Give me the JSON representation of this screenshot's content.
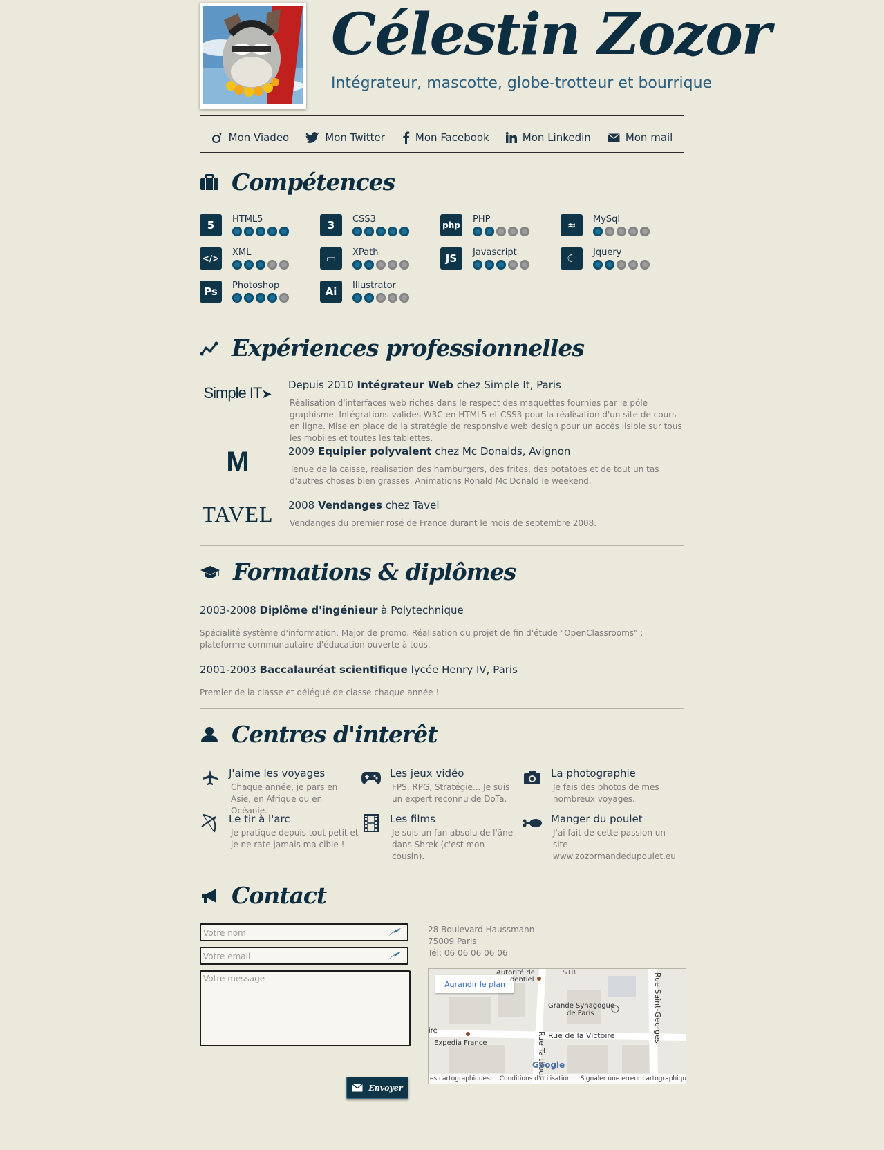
{
  "header": {
    "name": "Célestin Zozor",
    "tagline": "Intégrateur, mascotte, globe-trotteur et bourrique"
  },
  "nav": [
    {
      "label": "Mon Viadeo",
      "icon": "viadeo-icon"
    },
    {
      "label": "Mon Twitter",
      "icon": "twitter-icon"
    },
    {
      "label": "Mon Facebook",
      "icon": "facebook-icon"
    },
    {
      "label": "Mon Linkedin",
      "icon": "linkedin-icon"
    },
    {
      "label": "Mon mail",
      "icon": "mail-icon"
    }
  ],
  "skills": {
    "title": "Compétences",
    "items": [
      {
        "label": "HTML5",
        "glyph": "5",
        "icon": "html5-icon",
        "rating": 5
      },
      {
        "label": "CSS3",
        "glyph": "3",
        "icon": "css3-icon",
        "rating": 5
      },
      {
        "label": "PHP",
        "glyph": "php",
        "icon": "php-icon",
        "rating": 2
      },
      {
        "label": "MySql",
        "glyph": "≈",
        "icon": "mysql-icon",
        "rating": 1
      },
      {
        "label": "XML",
        "glyph": "</>",
        "icon": "xml-icon",
        "rating": 3
      },
      {
        "label": "XPath",
        "glyph": "▭",
        "icon": "xpath-icon",
        "rating": 2
      },
      {
        "label": "Javascript",
        "glyph": "JS",
        "icon": "javascript-icon",
        "rating": 3
      },
      {
        "label": "Jquery",
        "glyph": "☾",
        "icon": "jquery-icon",
        "rating": 2
      },
      {
        "label": "Photoshop",
        "glyph": "Ps",
        "icon": "photoshop-icon",
        "rating": 4
      },
      {
        "label": "Illustrator",
        "glyph": "Ai",
        "icon": "illustrator-icon",
        "rating": 2
      }
    ]
  },
  "experiences": {
    "title": "Expériences professionnelles",
    "items": [
      {
        "logo": "Simple IT",
        "pre": "Depuis 2010 ",
        "role": "Intégrateur Web",
        "post": " chez Simple It, Paris",
        "desc": "Réalisation d'interfaces web riches dans le respect des maquettes fournies par le pôle graphisme. Intégrations valides W3C en HTML5 et CSS3 pour la réalisation d'un site de cours en ligne. Mise en place de la stratégie de responsive web design pour un accès lisible sur tous les mobiles et toutes les tablettes."
      },
      {
        "logo": "M",
        "pre": "2009 ",
        "role": "Equipier polyvalent",
        "post": " chez Mc Donalds, Avignon",
        "desc": "Tenue de la caisse, réalisation des hamburgers, des frites, des potatoes et de tout un tas d'autres choses bien grasses. Animations Ronald Mc Donald le weekend."
      },
      {
        "logo": "TAVEL",
        "pre": "2008 ",
        "role": "Vendanges",
        "post": " chez Tavel",
        "desc": "Vendanges du premier rosé de France durant le mois de septembre 2008."
      }
    ]
  },
  "formations": {
    "title": "Formations & diplômes",
    "items": [
      {
        "pre": "2003-2008 ",
        "title": "Diplôme d'ingénieur",
        "post": " à Polytechnique",
        "desc": "Spécialité système d'information. Major de promo. Réalisation du projet de fin d'étude \"OpenClassrooms\" : plateforme communautaire d'éducation ouverte à tous."
      },
      {
        "pre": "2001-2003 ",
        "title": "Baccalauréat scientifique",
        "post": " lycée Henry IV, Paris",
        "desc": "Premier de la classe et délégué de classe chaque année !"
      }
    ]
  },
  "interests": {
    "title": "Centres d'interêt",
    "items": [
      {
        "icon": "plane-icon",
        "title": "J'aime les voyages",
        "desc": "Chaque année, je pars en Asie, en Afrique ou en Océanie."
      },
      {
        "icon": "gamepad-icon",
        "title": "Les jeux vidéo",
        "desc": "FPS, RPG, Stratégie... Je suis un expert reconnu de DoTa."
      },
      {
        "icon": "camera-icon",
        "title": "La photographie",
        "desc": "Je fais des photos de mes nombreux voyages."
      },
      {
        "icon": "bow-icon",
        "title": "Le tir à l'arc",
        "desc": "Je pratique depuis tout petit et je ne rate jamais ma cible !"
      },
      {
        "icon": "film-icon",
        "title": "Les films",
        "desc": "Je suis un fan absolu de l'âne dans Shrek (c'est mon cousin)."
      },
      {
        "icon": "chicken-leg-icon",
        "title": "Manger du poulet",
        "desc": "J'ai fait de cette passion un site www.zozormandedupoulet.eu"
      }
    ]
  },
  "contact": {
    "title": "Contact",
    "name_placeholder": "Votre nom",
    "email_placeholder": "Votre email",
    "message_placeholder": "Votre message",
    "send_label": "Envoyer",
    "address_line1": "28 Boulevard Haussmann",
    "address_line2": "75009 Paris",
    "phone": "Tél: 06 06 06 06 06",
    "map": {
      "enlarge": "Agrandir le plan",
      "labels": [
        "Autorité de",
        "dentiel",
        "Grande Synagogue",
        "de Paris",
        "Rue de la Victoire",
        "Expedia France",
        "Rue Saint-Georges",
        "Rue Taitbout",
        "ire",
        "STR"
      ],
      "footer": [
        "es cartographiques",
        "Conditions d'utilisation",
        "Signaler une erreur cartographique"
      ],
      "brand": "Google"
    }
  }
}
